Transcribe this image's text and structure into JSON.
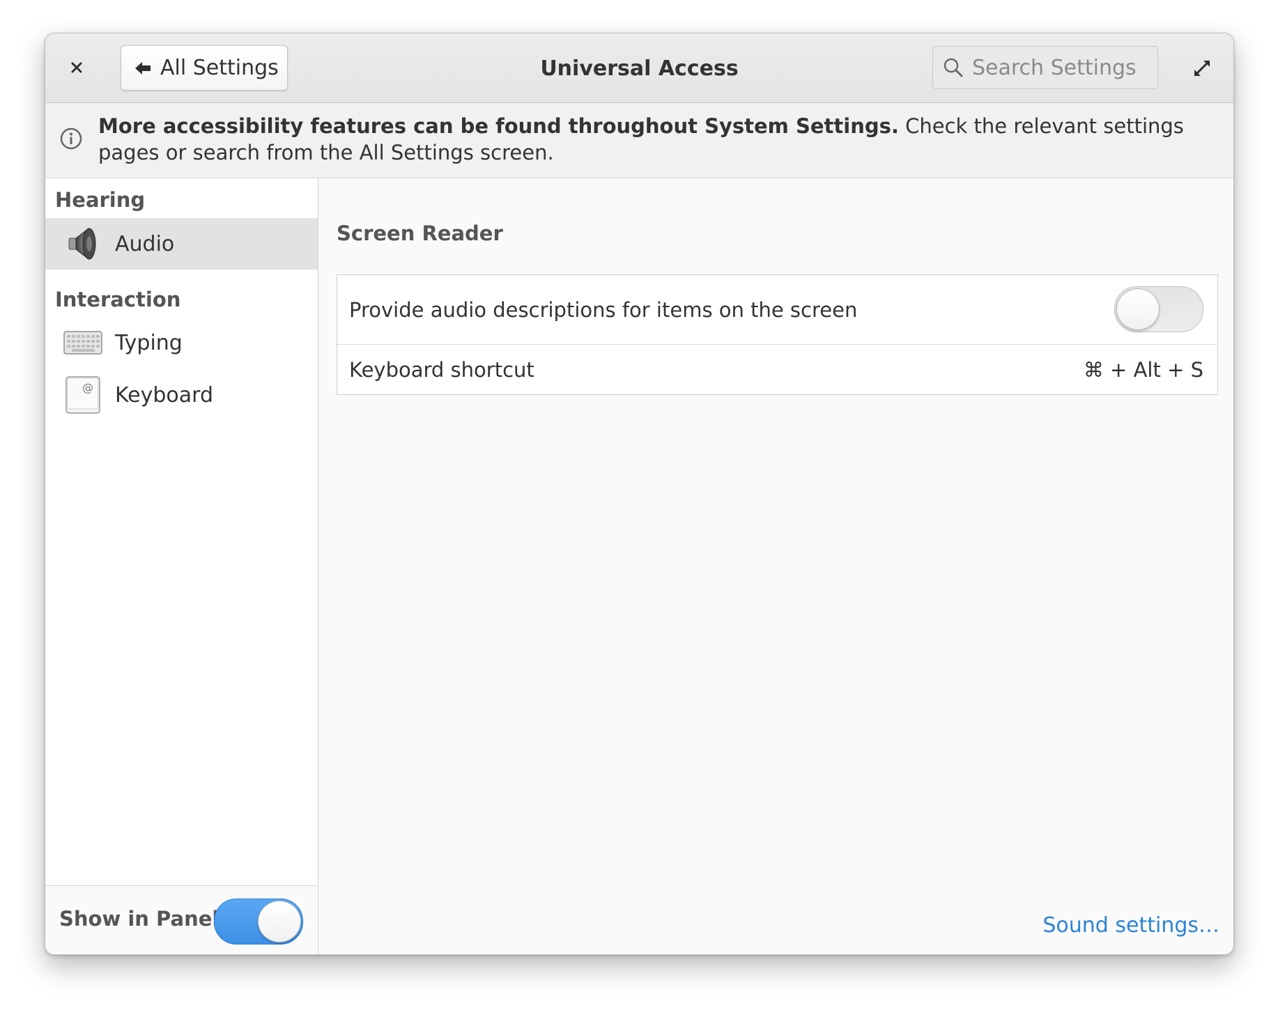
{
  "header": {
    "title": "Universal Access",
    "back_label": "All Settings",
    "search_placeholder": "Search Settings"
  },
  "infobar": {
    "bold_text": "More accessibility features can be found throughout System Settings.",
    "rest_text": " Check the relevant settings pages or search from the All Settings screen."
  },
  "sidebar": {
    "sections": [
      {
        "title": "Hearing"
      },
      {
        "title": "Interaction"
      }
    ],
    "items": [
      {
        "label": "Audio",
        "icon": "speaker-icon",
        "selected": true
      },
      {
        "label": "Typing",
        "icon": "keyboard-typing-icon",
        "selected": false
      },
      {
        "label": "Keyboard",
        "icon": "keyboard-at-icon",
        "selected": false
      }
    ],
    "footer": {
      "label": "Show in Panel",
      "enabled": true
    }
  },
  "main": {
    "group_title": "Screen Reader",
    "rows": [
      {
        "label": "Provide audio descriptions for items on the screen",
        "enabled": false
      },
      {
        "label": "Keyboard shortcut",
        "value": "⌘ + Alt + S"
      }
    ],
    "link_label": "Sound settings…"
  },
  "colors": {
    "accent": "#3d8fe6",
    "link": "#2d84d6",
    "selected_row": "#e2e2e2"
  }
}
